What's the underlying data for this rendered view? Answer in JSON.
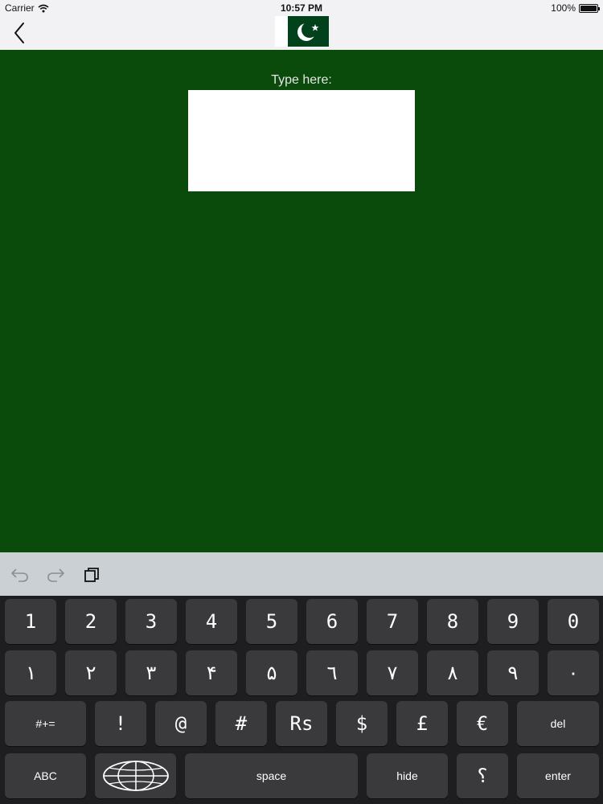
{
  "status_bar": {
    "carrier": "Carrier",
    "time": "10:57 PM",
    "battery": "100%"
  },
  "nav": {
    "back_icon": "chevron-left-icon",
    "flag_icon": "pakistan-flag-icon"
  },
  "main": {
    "prompt": "Type here:",
    "input_value": ""
  },
  "toolbar": {
    "undo_icon": "undo-icon",
    "redo_icon": "redo-icon",
    "copy_icon": "copy-icon"
  },
  "keyboard": {
    "row1": [
      "1",
      "2",
      "3",
      "4",
      "5",
      "6",
      "7",
      "8",
      "9",
      "0"
    ],
    "row2": [
      "١",
      "٢",
      "٣",
      "۴",
      "۵",
      "٦",
      "٧",
      "٨",
      "٩",
      "٠"
    ],
    "row3": {
      "symbols_label": "#+=",
      "keys": [
        "!",
        "@",
        "#",
        "Rs",
        "$",
        "£",
        "€"
      ],
      "delete_label": "del"
    },
    "row4": {
      "abc_label": "ABC",
      "globe_icon": "globe-icon",
      "space_label": "space",
      "hide_label": "hide",
      "question_label": "؟",
      "enter_label": "enter"
    }
  },
  "colors": {
    "background_green": "#0a4a0a",
    "flag_green": "#01411c",
    "key_bg": "#3a3a3d",
    "keyboard_bg": "#1e1e20",
    "toolbar_bg": "#cbd0d4"
  }
}
